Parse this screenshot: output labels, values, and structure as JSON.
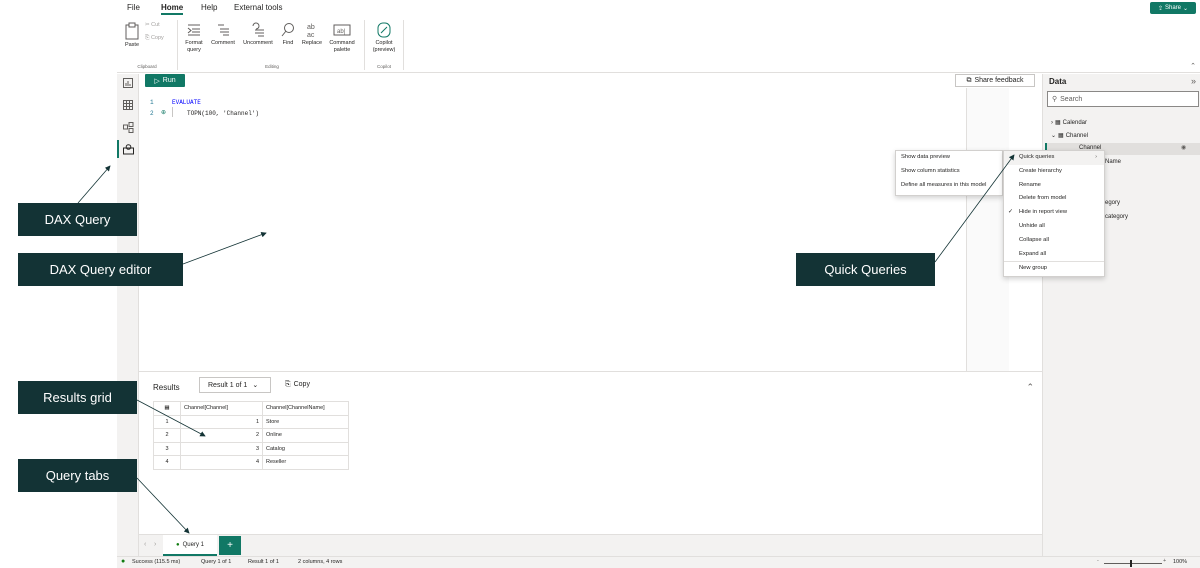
{
  "menu": {
    "file": "File",
    "home": "Home",
    "help": "Help",
    "external_tools": "External tools",
    "share": "Share"
  },
  "ribbon": {
    "paste": "Paste",
    "cut": "Cut",
    "copy": "Copy",
    "clipboard_group": "Clipboard",
    "format_query_1": "Format",
    "format_query_2": "query",
    "comment": "Comment",
    "uncomment": "Uncomment",
    "find": "Find",
    "replace": "Replace",
    "command_palette_1": "Command",
    "command_palette_2": "palette",
    "editing_group": "Editing",
    "copilot_1": "Copilot",
    "copilot_2": "(preview)",
    "copilot_group": "Copilot"
  },
  "editor": {
    "run": "Run",
    "share_feedback": "Share feedback",
    "lines": [
      {
        "num": "1",
        "text": "EVALUATE"
      },
      {
        "num": "2",
        "text": "TOPN(100, 'Channel')"
      }
    ]
  },
  "results": {
    "label": "Results",
    "selector": "Result 1 of 1",
    "copy": "Copy",
    "columns": [
      "Channel[Channel]",
      "Channel[ChannelName]"
    ],
    "rows": [
      [
        "1",
        "1",
        "Store"
      ],
      [
        "2",
        "2",
        "Online"
      ],
      [
        "3",
        "3",
        "Catalog"
      ],
      [
        "4",
        "4",
        "Reseller"
      ]
    ]
  },
  "tabs": {
    "query1": "Query 1",
    "add": "+"
  },
  "status": {
    "success": "Success (115.5 ms)",
    "query": "Query 1 of 1",
    "result": "Result 1 of 1",
    "shape": "2 columns, 4 rows",
    "zoom": "100%"
  },
  "data_pane": {
    "title": "Data",
    "search_placeholder": "Search",
    "tables": [
      "Calendar",
      "Channel"
    ],
    "selected_field": "Channel",
    "partial": [
      "Name",
      "egory",
      "category"
    ]
  },
  "context_menu_left": [
    "Show data preview",
    "Show column statistics",
    "Define all measures in this model"
  ],
  "context_menu_right": [
    "Quick queries",
    "Create hierarchy",
    "Rename",
    "Delete from model",
    "Hide in report view",
    "Unhide all",
    "Collapse all",
    "Expand all",
    "New group"
  ],
  "callouts": {
    "dax_query": "DAX Query",
    "dax_editor": "DAX Query editor",
    "quick_queries": "Quick Queries",
    "results_grid": "Results grid",
    "query_tabs": "Query tabs"
  },
  "colors": {
    "accent": "#117865",
    "callout": "#133335",
    "keyword": "#0000ff"
  }
}
